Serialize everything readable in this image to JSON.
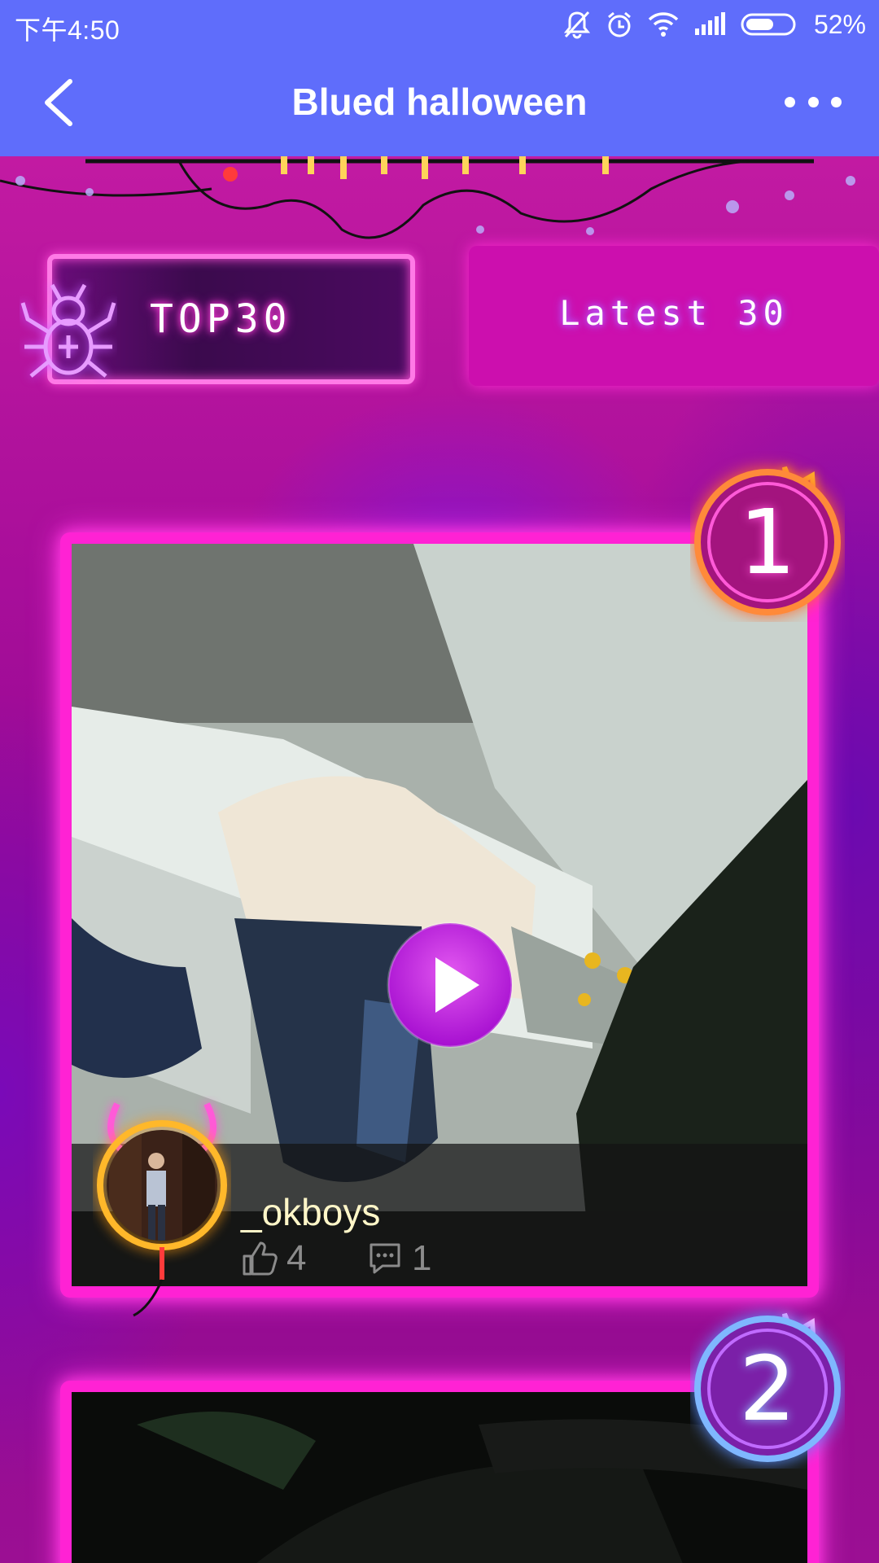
{
  "status_bar": {
    "time": "下午4:50",
    "battery": "52%",
    "icons": [
      "mute-icon",
      "alarm-icon",
      "wifi-icon",
      "signal-icon",
      "battery-icon"
    ]
  },
  "app_bar": {
    "title": "Blued halloween",
    "back_icon": "chevron-left-icon",
    "more_icon": "more-dots-icon"
  },
  "tabs": {
    "top": "TOP30",
    "latest": "Latest 30"
  },
  "cards": [
    {
      "rank": "1",
      "username": "_okboys",
      "likes": "4",
      "comments": "1"
    },
    {
      "rank": "2"
    }
  ],
  "colors": {
    "header": "#5f6dfb",
    "neon_pink": "#ff22d4",
    "tab_latest": "#cc0fae",
    "username": "#fff6c8"
  }
}
